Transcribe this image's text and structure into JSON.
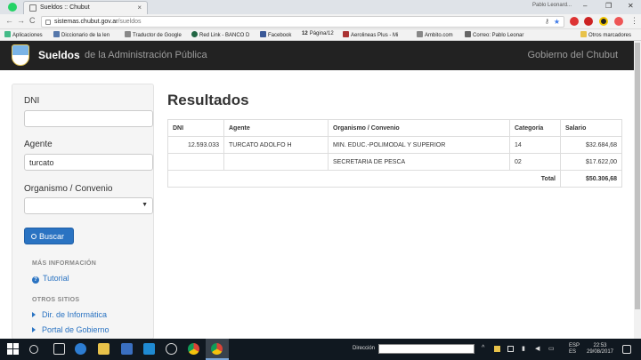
{
  "browser": {
    "tab_title": "Sueldos :: Chubut",
    "tab_close": "×",
    "profile": "Pablo Leonard...",
    "win_min": "–",
    "win_max": "❐",
    "win_close": "✕",
    "url_host": "sistemas.chubut.gov.ar",
    "url_path": "/sueldos",
    "back": "←",
    "forward": "→",
    "reload": "C",
    "star": "★",
    "menu": "⋮",
    "bookmarks": [
      "Aplicaciones",
      "Diccionario de la len",
      "Traductor de Google",
      "Red Link - BANCO D",
      "Facebook",
      "Página/12",
      "Aerolineas Plus - Mi",
      "Ambito.com",
      "Correo: Pablo Leonar",
      "Otros marcadores"
    ],
    "bookmark_12": "12"
  },
  "header": {
    "brand": "Sueldos",
    "brand_sub": "de la Administración Pública",
    "right": "Gobierno del Chubut"
  },
  "sidebar": {
    "dni_label": "DNI",
    "dni_value": "",
    "agente_label": "Agente",
    "agente_value": "turcato",
    "organismo_label": "Organismo / Convenio",
    "organismo_value": "",
    "caret": "▼",
    "search_button": "Buscar",
    "more_info_title": "MÁS INFORMACIÓN",
    "tutorial_icon": "?",
    "tutorial_link": "Tutorial",
    "other_sites_title": "OTROS SITIOS",
    "link1": "Dir. de Informática",
    "link2": "Portal de Gobierno"
  },
  "results": {
    "title": "Resultados",
    "columns": [
      "DNI",
      "Agente",
      "Organismo / Convenio",
      "Categoría",
      "Salario"
    ],
    "rows": [
      [
        "12.593.033",
        "TURCATO ADOLFO H",
        "MIN. EDUC.-POLIMODAL Y SUPERIOR",
        "14",
        "$32.684,68"
      ],
      [
        "",
        "",
        "SECRETARIA DE PESCA",
        "02",
        "$17.622,00"
      ]
    ],
    "total_label": "Total",
    "total_value": "$50.306,68"
  },
  "taskbar": {
    "direccion_label": "Dirección",
    "lang_top": "ESP",
    "lang_bottom": "ES",
    "time": "22:53",
    "date": "29/08/2017"
  },
  "colors": {
    "navbar": "#222222",
    "link": "#2a73c2",
    "button": "#2a73c2"
  }
}
